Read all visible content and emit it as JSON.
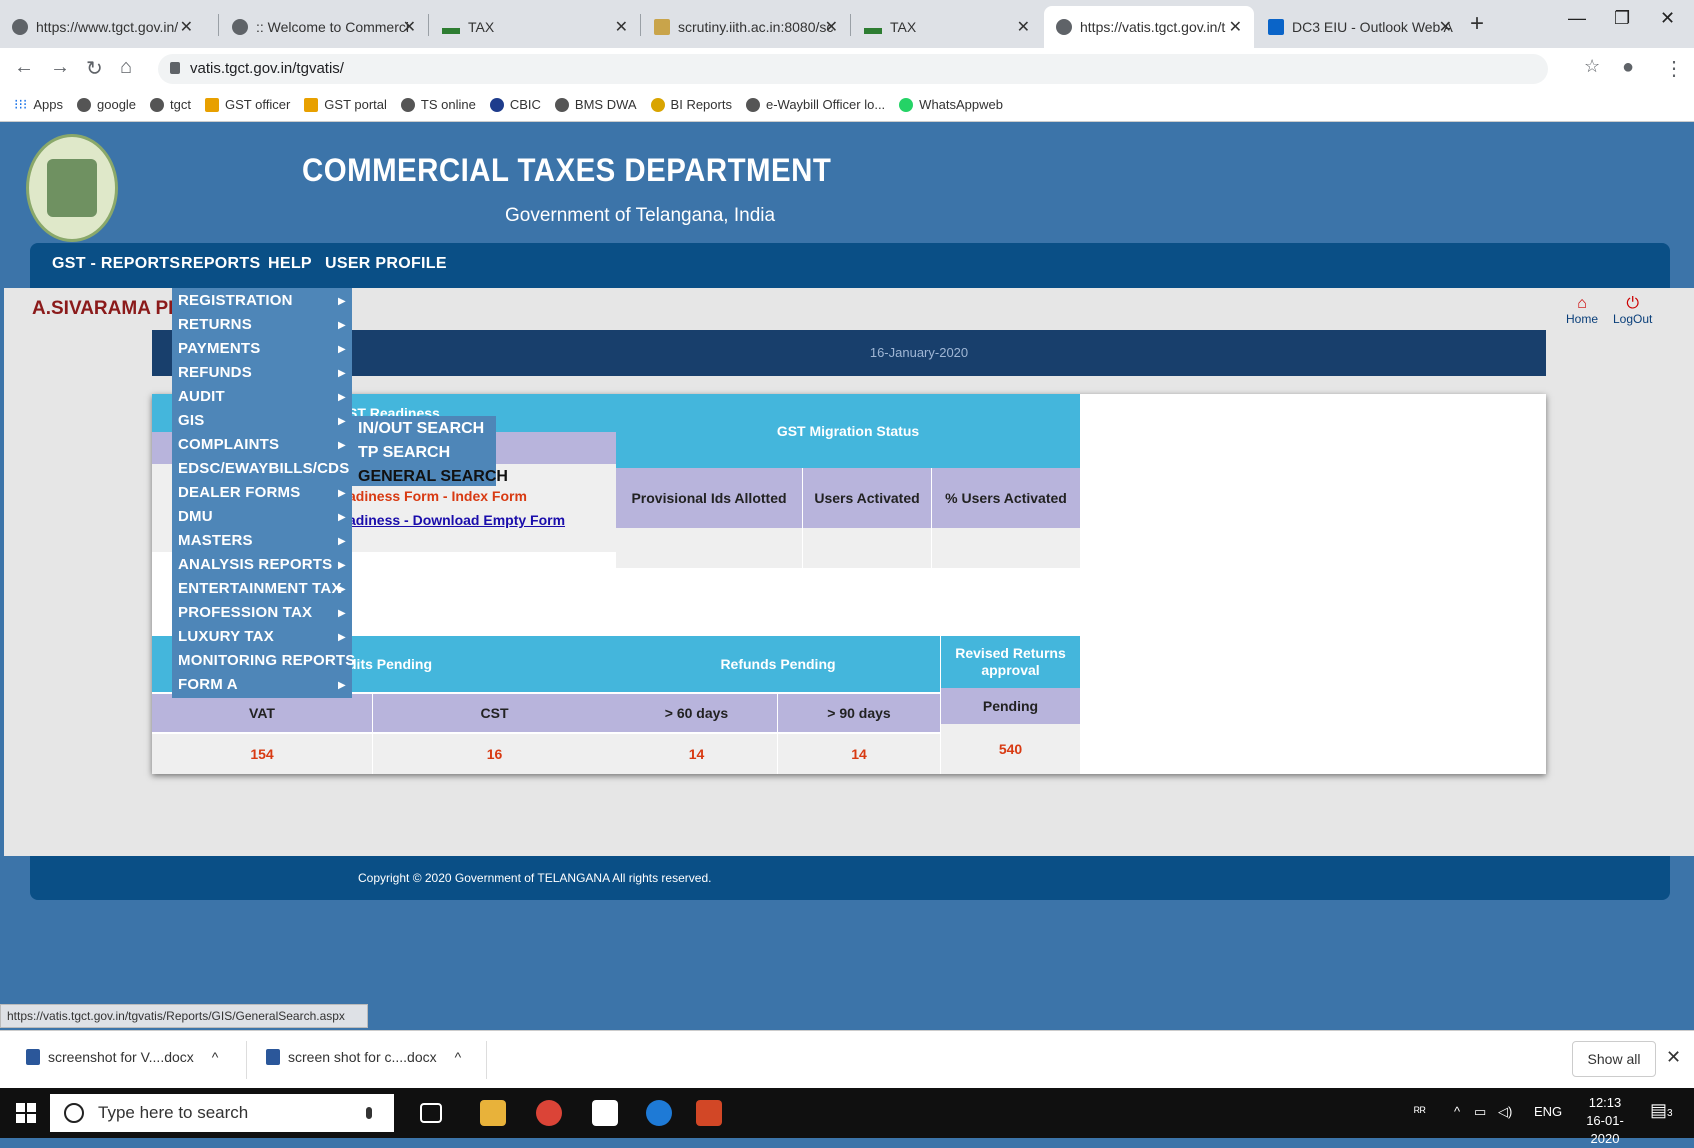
{
  "browser": {
    "tabs": [
      {
        "title": "https://www.tgct.gov.in/",
        "icon": "globe-icon"
      },
      {
        "title": ":: Welcome to Commerci",
        "icon": "globe-icon"
      },
      {
        "title": "TAX",
        "icon": "tax-favicon"
      },
      {
        "title": "scrutiny.iith.ac.in:8080/sc",
        "icon": "image-favicon"
      },
      {
        "title": "TAX",
        "icon": "tax-favicon"
      },
      {
        "title": "https://vatis.tgct.gov.in/t",
        "icon": "globe-icon",
        "active": true
      },
      {
        "title": "DC3 EIU - Outlook Web A",
        "icon": "outlook-icon"
      }
    ],
    "url": "vatis.tgct.gov.in/tgvatis/",
    "bookmarks": [
      "Apps",
      "google",
      "tgct",
      "GST officer",
      "GST portal",
      "TS online",
      "CBIC",
      "BMS DWA",
      "BI Reports",
      "e-Waybill Officer lo...",
      "WhatsAppweb"
    ],
    "status_url": "https://vatis.tgct.gov.in/tgvatis/Reports/GIS/GeneralSearch.aspx"
  },
  "header": {
    "title": "COMMERCIAL TAXES DEPARTMENT",
    "subtitle": "Government of Telangana, India"
  },
  "menu": {
    "top": [
      "GST - REPORTS",
      "REPORTS",
      "HELP",
      "USER PROFILE"
    ],
    "reports_items": [
      "REGISTRATION",
      "RETURNS",
      "PAYMENTS",
      "REFUNDS",
      "AUDIT",
      "GIS",
      "COMPLAINTS",
      "EDSC/EWAYBILLS/CDSC",
      "DEALER FORMS",
      "DMU",
      "MASTERS",
      "ANALYSIS REPORTS",
      "ENTERTAINMENT TAX",
      "PROFESSION TAX",
      "LUXURY TAX",
      "MONITORING REPORTS",
      "FORM A"
    ],
    "gis_submenu": [
      "IN/OUT SEARCH",
      "TP SEARCH",
      "GENERAL SEARCH"
    ]
  },
  "user": {
    "name": "A.SIVARAMA PR"
  },
  "top_links": {
    "home": "Home",
    "logout": "LogOut"
  },
  "date": "16-January-2020",
  "gst_readiness": {
    "title_fragment": "ST Readiness",
    "link_index": "adiness Form - Index Form",
    "link_download": "adiness - Download Empty Form"
  },
  "gst_migration": {
    "title": "GST Migration Status",
    "headers": [
      "Provisional Ids Allotted",
      "Users Activated",
      "% Users Activated"
    ]
  },
  "audits": {
    "title_fragment": "dits Pending",
    "headers": [
      "VAT",
      "CST"
    ],
    "values": [
      "154",
      "16"
    ]
  },
  "refunds": {
    "title": "Refunds Pending",
    "headers": [
      "> 60 days",
      "> 90 days"
    ],
    "values": [
      "14",
      "14"
    ]
  },
  "revised": {
    "title": "Revised Returns approval",
    "header": "Pending",
    "value": "540"
  },
  "footer": "Copyright © 2020 Government of TELANGANA All rights reserved.",
  "downloads": {
    "items": [
      "screenshot for V....docx",
      "screen shot for c....docx"
    ],
    "show_all": "Show all"
  },
  "taskbar": {
    "search_placeholder": "Type here to search",
    "lang": "ENG",
    "time": "12:13",
    "date": "16-01-2020",
    "notif_count": "3"
  }
}
